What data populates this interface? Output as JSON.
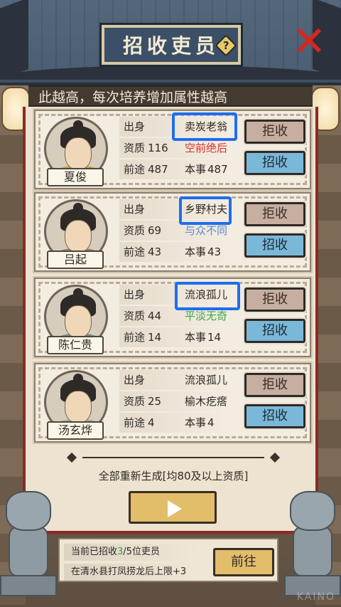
{
  "header": {
    "title": "招收吏员",
    "help_symbol": "?",
    "close_symbol": "✕"
  },
  "marquee": "此越高，每次培养增加属性越高",
  "labels": {
    "origin": "出身",
    "aptitude": "资质",
    "prospect": "前途",
    "skill": "本事",
    "reject": "拒收",
    "accept": "招收"
  },
  "candidates": [
    {
      "name": "夏俊",
      "origin": "卖炭老翁",
      "aptitude": "116",
      "trait": "空前绝后",
      "trait_color": "#e0302a",
      "prospect": "487",
      "skill": "487",
      "robe_color": "#c9a64a"
    },
    {
      "name": "吕起",
      "origin": "乡野村夫",
      "aptitude": "69",
      "trait": "与众不同",
      "trait_color": "#5a88d8",
      "prospect": "43",
      "skill": "43",
      "robe_color": "#8d8f72"
    },
    {
      "name": "陈仁贵",
      "origin": "流浪孤儿",
      "aptitude": "44",
      "trait": "平淡无奇",
      "trait_color": "#3aa84b",
      "prospect": "14",
      "skill": "14",
      "robe_color": "#7f8c8a"
    },
    {
      "name": "汤玄烨",
      "origin": "流浪孤儿",
      "aptitude": "25",
      "trait": "榆木疙瘩",
      "trait_color": "#2e2a25",
      "prospect": "4",
      "skill": "4",
      "robe_color": "#9fb3a8"
    }
  ],
  "regenerate": {
    "label": "全部重新生成[均80及以上资质]"
  },
  "bottom": {
    "recruited_prefix": "当前已招收",
    "recruited_count": "3",
    "recruited_suffix": "/5位吏员",
    "limit_text": "在清水县打凤捞龙后上限+3",
    "go_label": "前往"
  },
  "watermark": "KAINO",
  "colors": {
    "highlight": "#1e6df0",
    "accept_button": "#7ab8d9",
    "reject_button": "#c6aea0",
    "panel_border": "#8b2a24"
  }
}
